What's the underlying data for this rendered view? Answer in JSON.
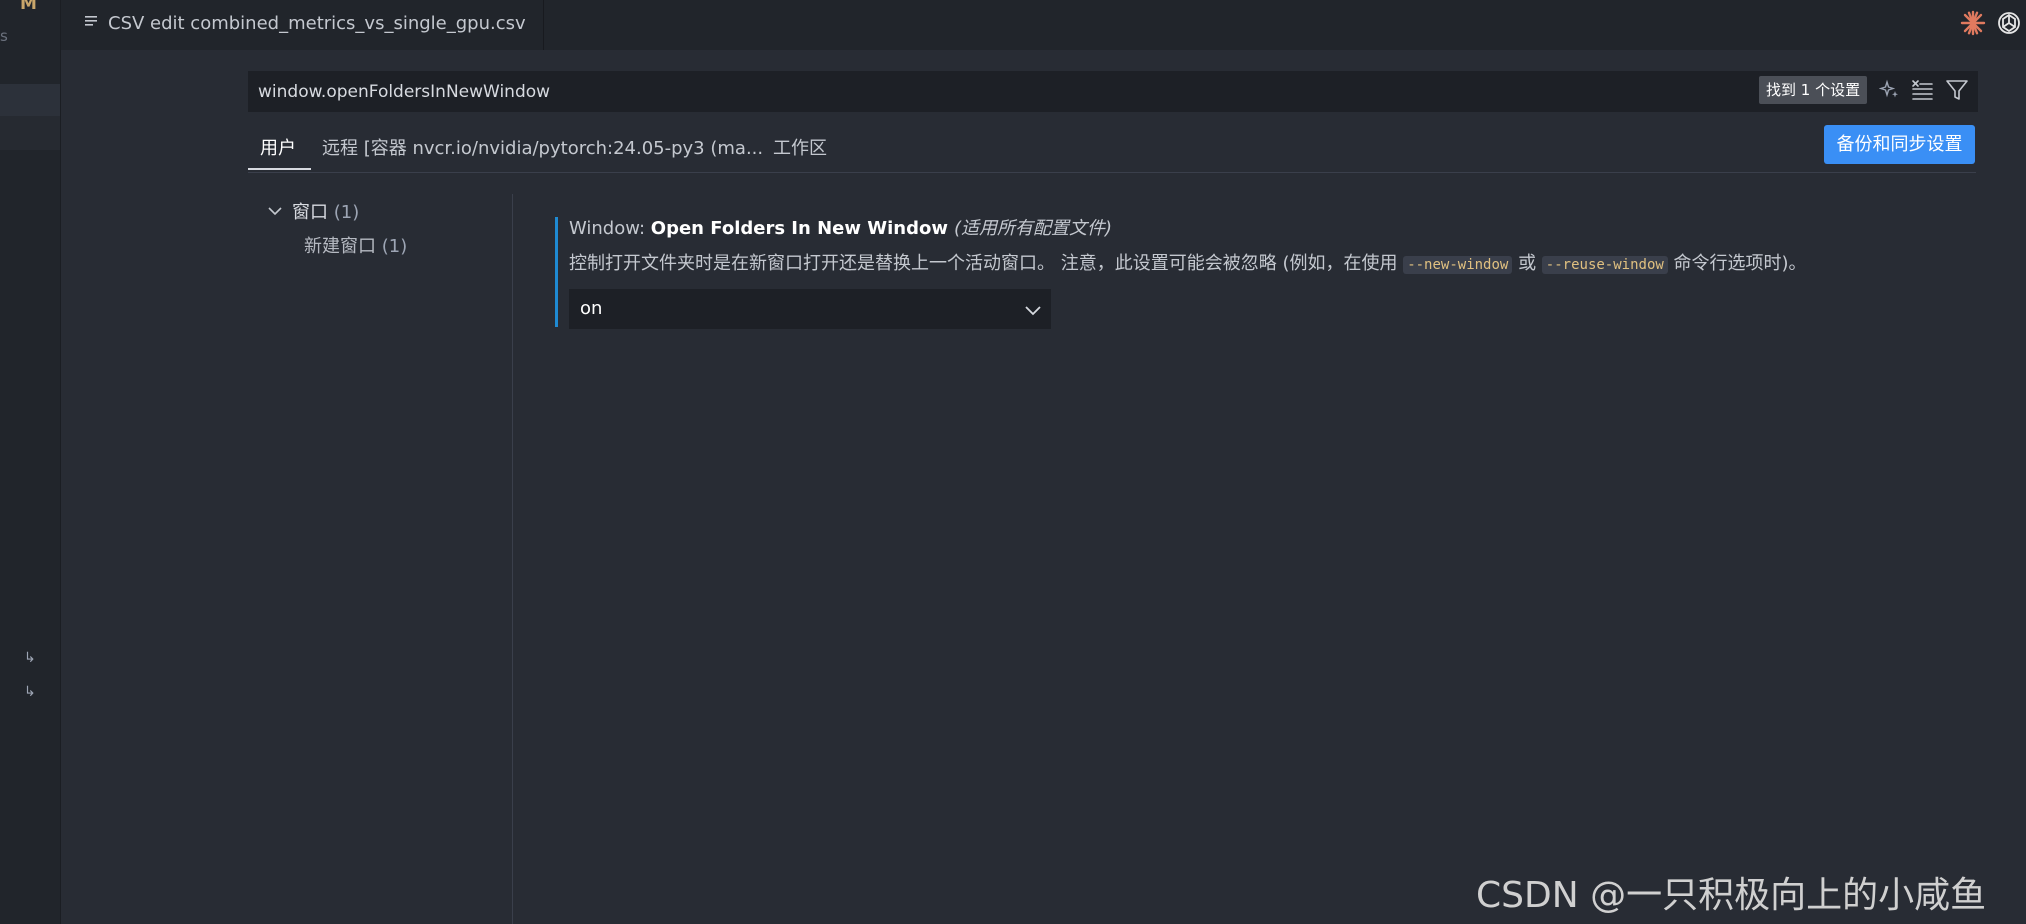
{
  "left_strip": {
    "letter": "M",
    "fragment": "s",
    "arrows": [
      "↳",
      "↳"
    ]
  },
  "editor_tab": {
    "icon": "file-lines-icon",
    "label": "CSV edit combined_metrics_vs_single_gpu.csv"
  },
  "top_right_icons": [
    "claude-burst-icon",
    "openai-icon"
  ],
  "search": {
    "value": "window.openFoldersInNewWindow",
    "found": "找到 1 个设置"
  },
  "scope_tabs": [
    {
      "label": "用户",
      "active": true
    },
    {
      "label": "远程 [容器 nvcr.io/nvidia/pytorch:24.05-py3 (ma...",
      "active": false
    },
    {
      "label": "工作区",
      "active": false
    }
  ],
  "sync_button": "备份和同步设置",
  "toc": {
    "group": {
      "label": "窗口",
      "count": "(1)"
    },
    "child": {
      "label": "新建窗口",
      "count": "(1)"
    }
  },
  "setting": {
    "category": "Window: ",
    "name": "Open Folders In New Window",
    "scope": "(适用所有配置文件)",
    "desc_part1": "控制打开文件夹时是在新窗口打开还是替换上一个活动窗口。 注意，此设置可能会被忽略 (例如，在使用 ",
    "code1": "--new-window",
    "desc_part2": " 或 ",
    "code2": "--reuse-window",
    "desc_part3": " 命令行选项时)。",
    "value": "on"
  },
  "watermark": "CSDN @一只积极向上的小咸鱼",
  "colors": {
    "accent": "#3a8ff5",
    "modified_bar": "#1f8ad2",
    "background": "#282c34"
  }
}
